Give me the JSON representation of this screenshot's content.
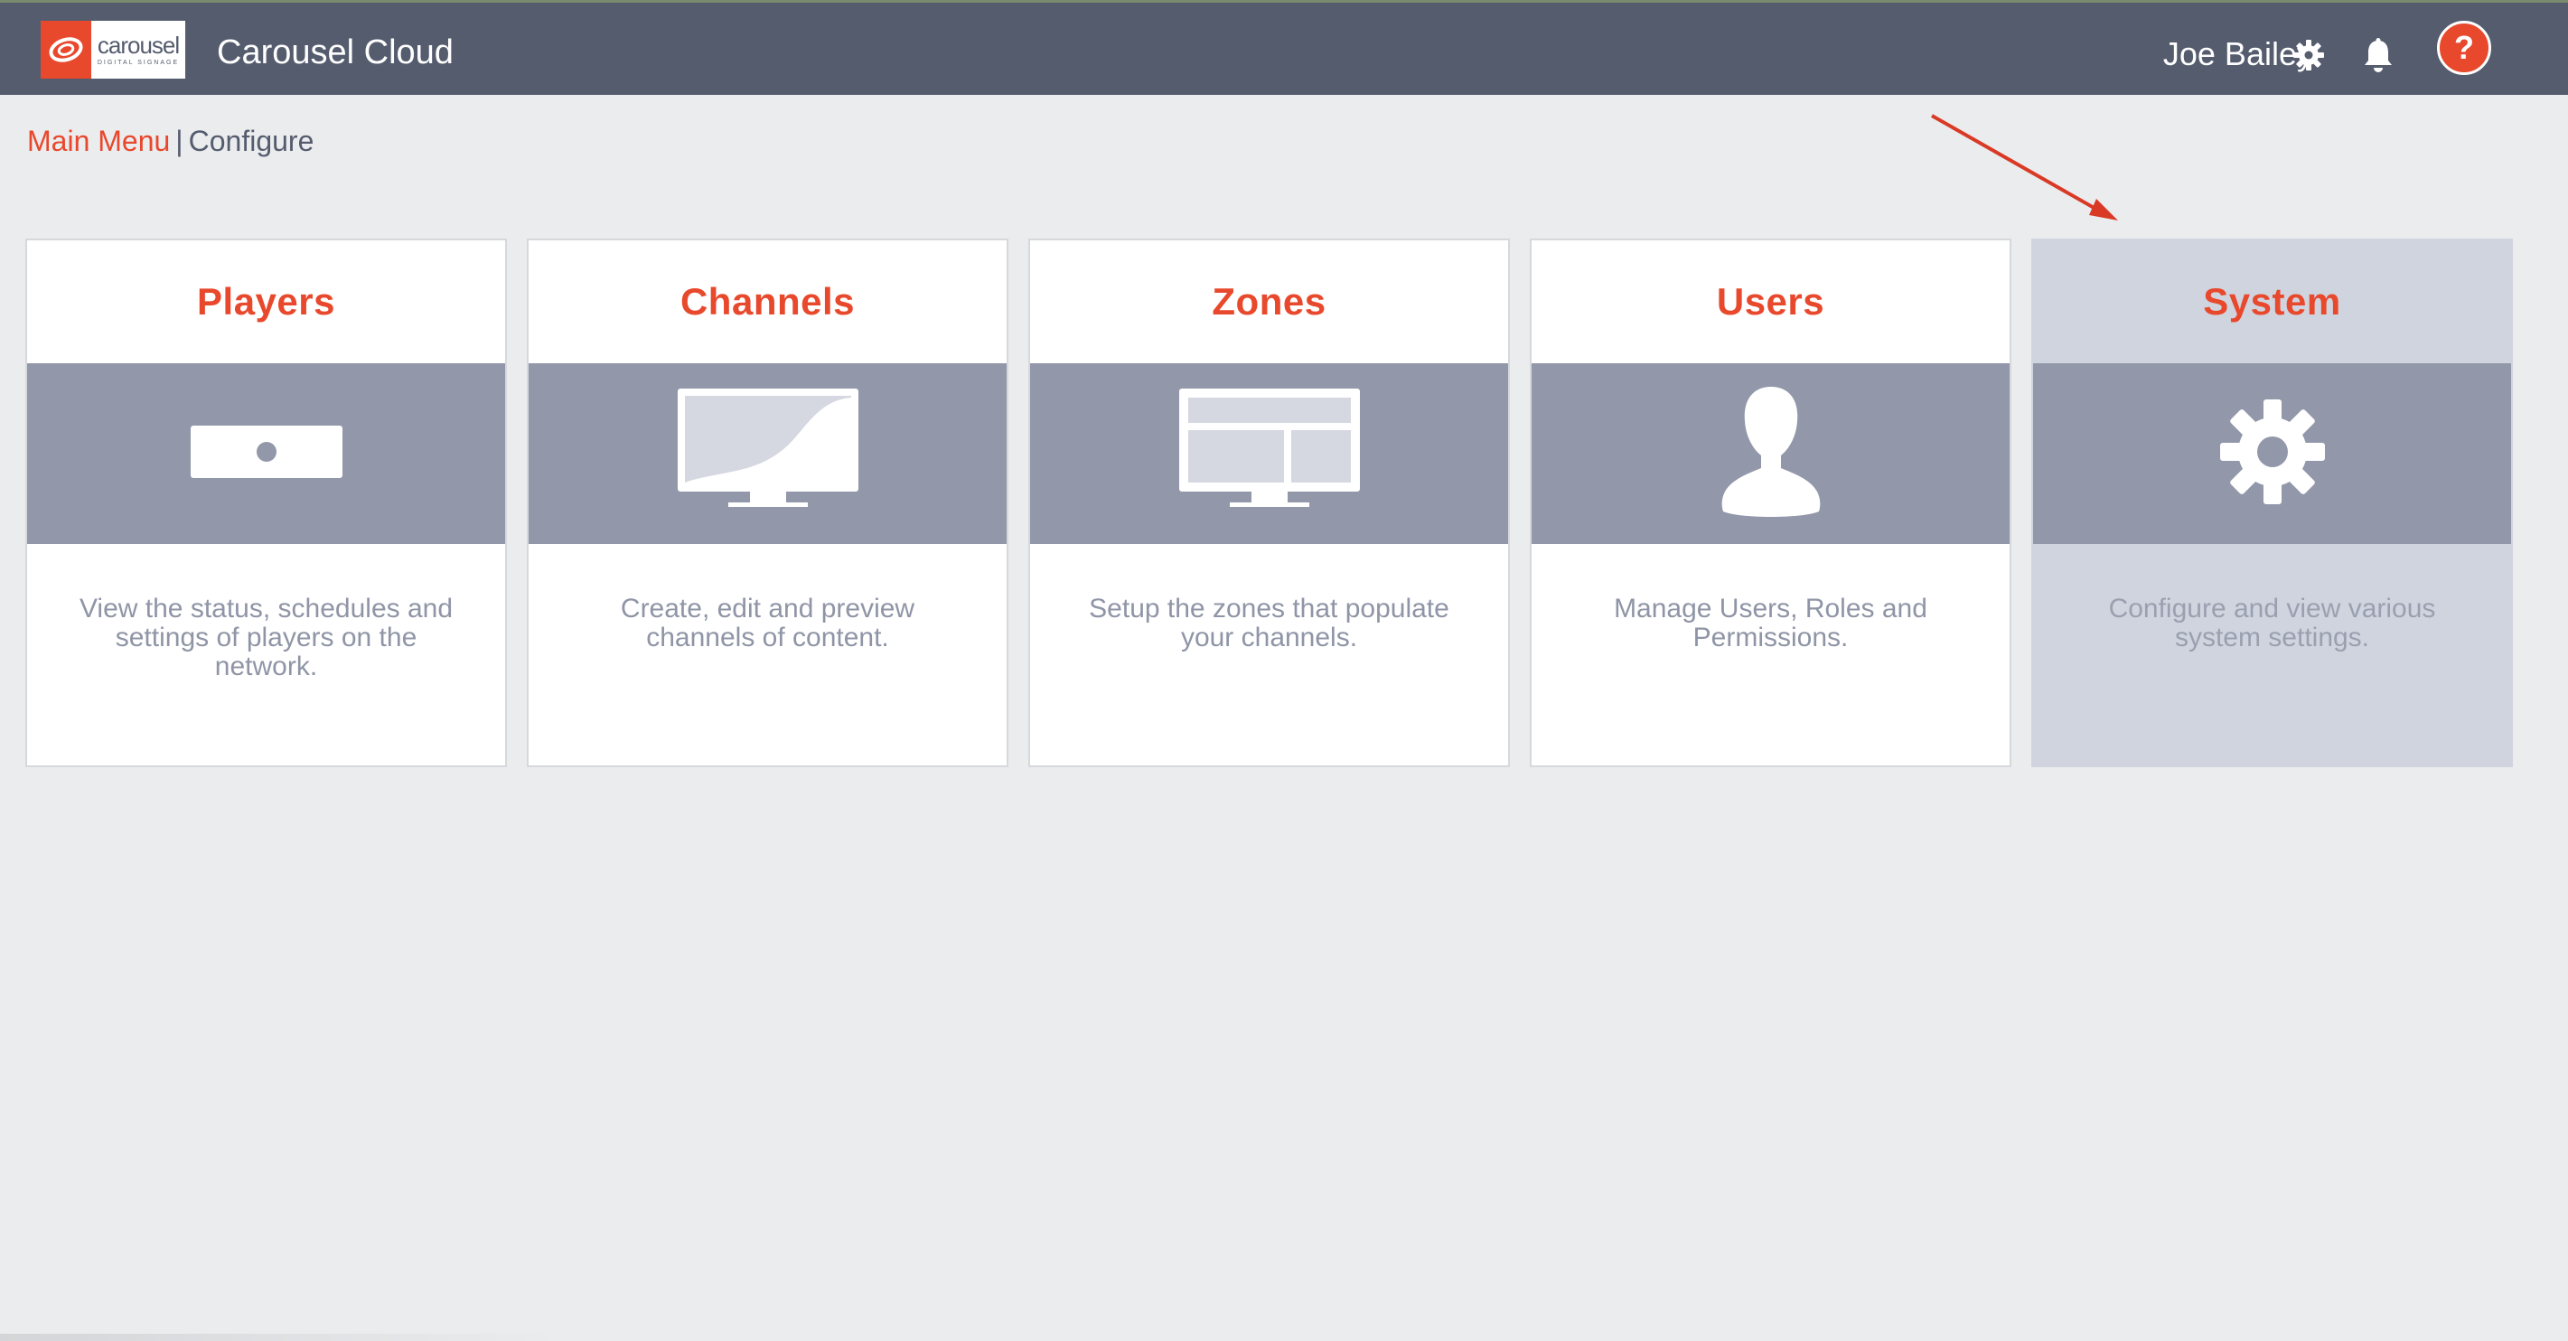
{
  "header": {
    "logo_word": "carousel",
    "logo_sub": "DIGITAL SIGNAGE",
    "app_title": "Carousel Cloud",
    "user_name": "Joe Bailey",
    "help_label": "?"
  },
  "breadcrumb": {
    "main_menu": "Main Menu",
    "separator": "|",
    "current": "Configure"
  },
  "cards": [
    {
      "title": "Players",
      "description": "View the status, schedules and settings of players on the network.",
      "icon": "player-device-icon"
    },
    {
      "title": "Channels",
      "description": "Create, edit and preview channels of content.",
      "icon": "monitor-icon"
    },
    {
      "title": "Zones",
      "description": "Setup the zones that populate your channels.",
      "icon": "zones-layout-icon"
    },
    {
      "title": "Users",
      "description": "Manage Users, Roles and Permissions.",
      "icon": "user-silhouette-icon"
    },
    {
      "title": "System",
      "description": "Configure and view various system settings.",
      "icon": "gear-icon",
      "highlighted": true
    }
  ],
  "colors": {
    "header_bg": "#555c6e",
    "accent": "#e8482c",
    "band": "#9298aa",
    "active_card": "#d0d4de",
    "page_bg": "#ebecee"
  }
}
